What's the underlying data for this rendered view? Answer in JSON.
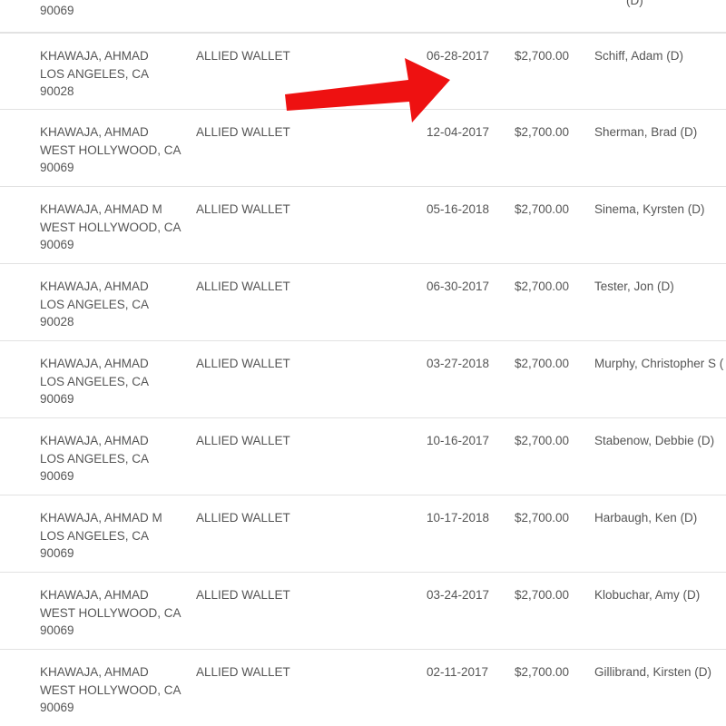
{
  "partial_top_row": {
    "contributor_zip": "90069",
    "recipient_tail": "(D)"
  },
  "rows": [
    {
      "contributor_name": "KHAWAJA, AHMAD",
      "contributor_city": "LOS ANGELES, CA",
      "contributor_zip": "90028",
      "employer": "ALLIED WALLET",
      "date": "06-28-2017",
      "amount": "$2,700.00",
      "recipient": "Schiff, Adam (D)"
    },
    {
      "contributor_name": "KHAWAJA, AHMAD",
      "contributor_city": "WEST HOLLYWOOD, CA",
      "contributor_zip": "90069",
      "employer": "ALLIED WALLET",
      "date": "12-04-2017",
      "amount": "$2,700.00",
      "recipient": "Sherman, Brad (D)"
    },
    {
      "contributor_name": "KHAWAJA, AHMAD M",
      "contributor_city": "WEST HOLLYWOOD, CA",
      "contributor_zip": "90069",
      "employer": "ALLIED WALLET",
      "date": "05-16-2018",
      "amount": "$2,700.00",
      "recipient": "Sinema, Kyrsten (D)"
    },
    {
      "contributor_name": "KHAWAJA, AHMAD",
      "contributor_city": "LOS ANGELES, CA",
      "contributor_zip": "90028",
      "employer": "ALLIED WALLET",
      "date": "06-30-2017",
      "amount": "$2,700.00",
      "recipient": "Tester, Jon (D)"
    },
    {
      "contributor_name": "KHAWAJA, AHMAD",
      "contributor_city": "LOS ANGELES, CA",
      "contributor_zip": "90069",
      "employer": "ALLIED WALLET",
      "date": "03-27-2018",
      "amount": "$2,700.00",
      "recipient": "Murphy, Christopher S ("
    },
    {
      "contributor_name": "KHAWAJA, AHMAD",
      "contributor_city": "LOS ANGELES, CA",
      "contributor_zip": "90069",
      "employer": "ALLIED WALLET",
      "date": "10-16-2017",
      "amount": "$2,700.00",
      "recipient": "Stabenow, Debbie (D)"
    },
    {
      "contributor_name": "KHAWAJA, AHMAD M",
      "contributor_city": "LOS ANGELES, CA",
      "contributor_zip": "90069",
      "employer": "ALLIED WALLET",
      "date": "10-17-2018",
      "amount": "$2,700.00",
      "recipient": "Harbaugh, Ken (D)"
    },
    {
      "contributor_name": "KHAWAJA, AHMAD",
      "contributor_city": "WEST HOLLYWOOD, CA",
      "contributor_zip": "90069",
      "employer": "ALLIED WALLET",
      "date": "03-24-2017",
      "amount": "$2,700.00",
      "recipient": "Klobuchar, Amy (D)"
    },
    {
      "contributor_name": "KHAWAJA, AHMAD",
      "contributor_city": "WEST HOLLYWOOD, CA",
      "contributor_zip": "90069",
      "employer": "ALLIED WALLET",
      "date": "02-11-2017",
      "amount": "$2,700.00",
      "recipient": "Gillibrand, Kirsten (D)"
    }
  ],
  "annotation": {
    "arrow_color": "#ee1111",
    "arrow_icon": "red-arrow-annotation"
  },
  "colors": {
    "text": "#555555",
    "divider": "#e2e2e2",
    "background": "#ffffff"
  }
}
